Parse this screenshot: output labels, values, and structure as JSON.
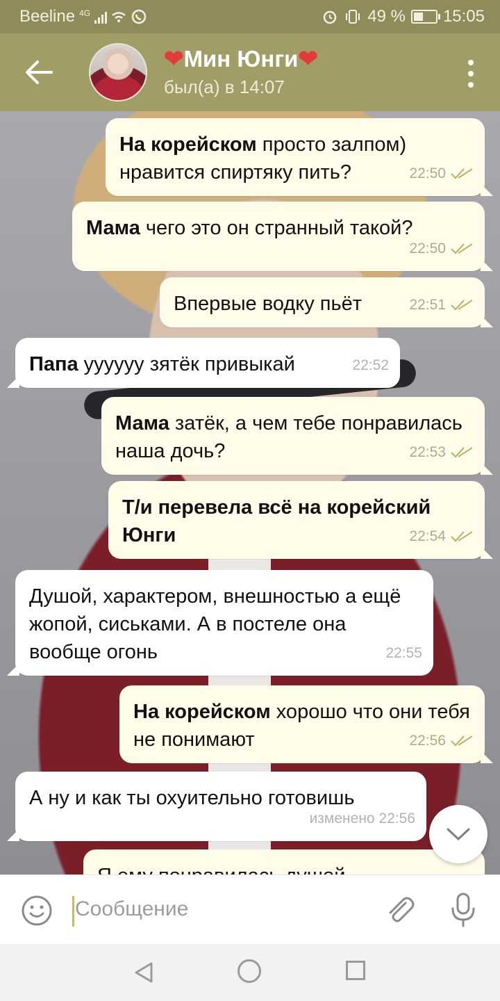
{
  "status_bar": {
    "carrier": "Beeline",
    "network": "4G",
    "battery": "49 %",
    "battery_level": 0.49,
    "time": "15:05"
  },
  "header": {
    "contact_name": "Мин Юнги",
    "status": "был(а) в 14:07",
    "heart_glyph": "❤"
  },
  "messages": [
    {
      "dir": "out",
      "bold": "На корейском",
      "text": " просто залпом) нравится спиртяку пить?",
      "time": "22:50",
      "read": true
    },
    {
      "dir": "out",
      "bold": "Мама",
      "text": " чего это он странный такой?",
      "time": "22:50",
      "read": true
    },
    {
      "dir": "out",
      "bold": "",
      "text": "Впервые водку пьёт",
      "time": "22:51",
      "read": true
    },
    {
      "dir": "in",
      "bold": "Папа",
      "text": " уууууу зятёк привыкай",
      "time": "22:52"
    },
    {
      "dir": "out",
      "bold": "Мама",
      "text": " затёк, а чем тебе понравилась наша дочь?",
      "time": "22:53",
      "read": true
    },
    {
      "dir": "out",
      "bold": "Т/и перевела всё на корейский Юнги",
      "text": "",
      "time": "22:54",
      "read": true
    },
    {
      "dir": "in",
      "bold": "",
      "text": "Душой, характером, внешностью а ещё жопой, сиськами. А в постеле она вообще огонь",
      "time": "22:55"
    },
    {
      "dir": "out",
      "bold": "На корейском",
      "text": " хорошо что они тебя не понимают",
      "time": "22:56",
      "read": true
    },
    {
      "dir": "in",
      "bold": "",
      "text": "А ну и как ты охуительно готовишь",
      "time": "изменено 22:56"
    },
    {
      "dir": "out",
      "bold": "",
      "text": "Я ему понравилась душой",
      "time": ""
    }
  ],
  "input": {
    "placeholder": "Сообщение"
  },
  "colors": {
    "header_bg": "#a09d67",
    "statusbar_bg": "#8f8c5a",
    "outgoing_bubble": "#fffde9",
    "incoming_bubble": "#ffffff",
    "tick_color": "#b9b66f"
  }
}
